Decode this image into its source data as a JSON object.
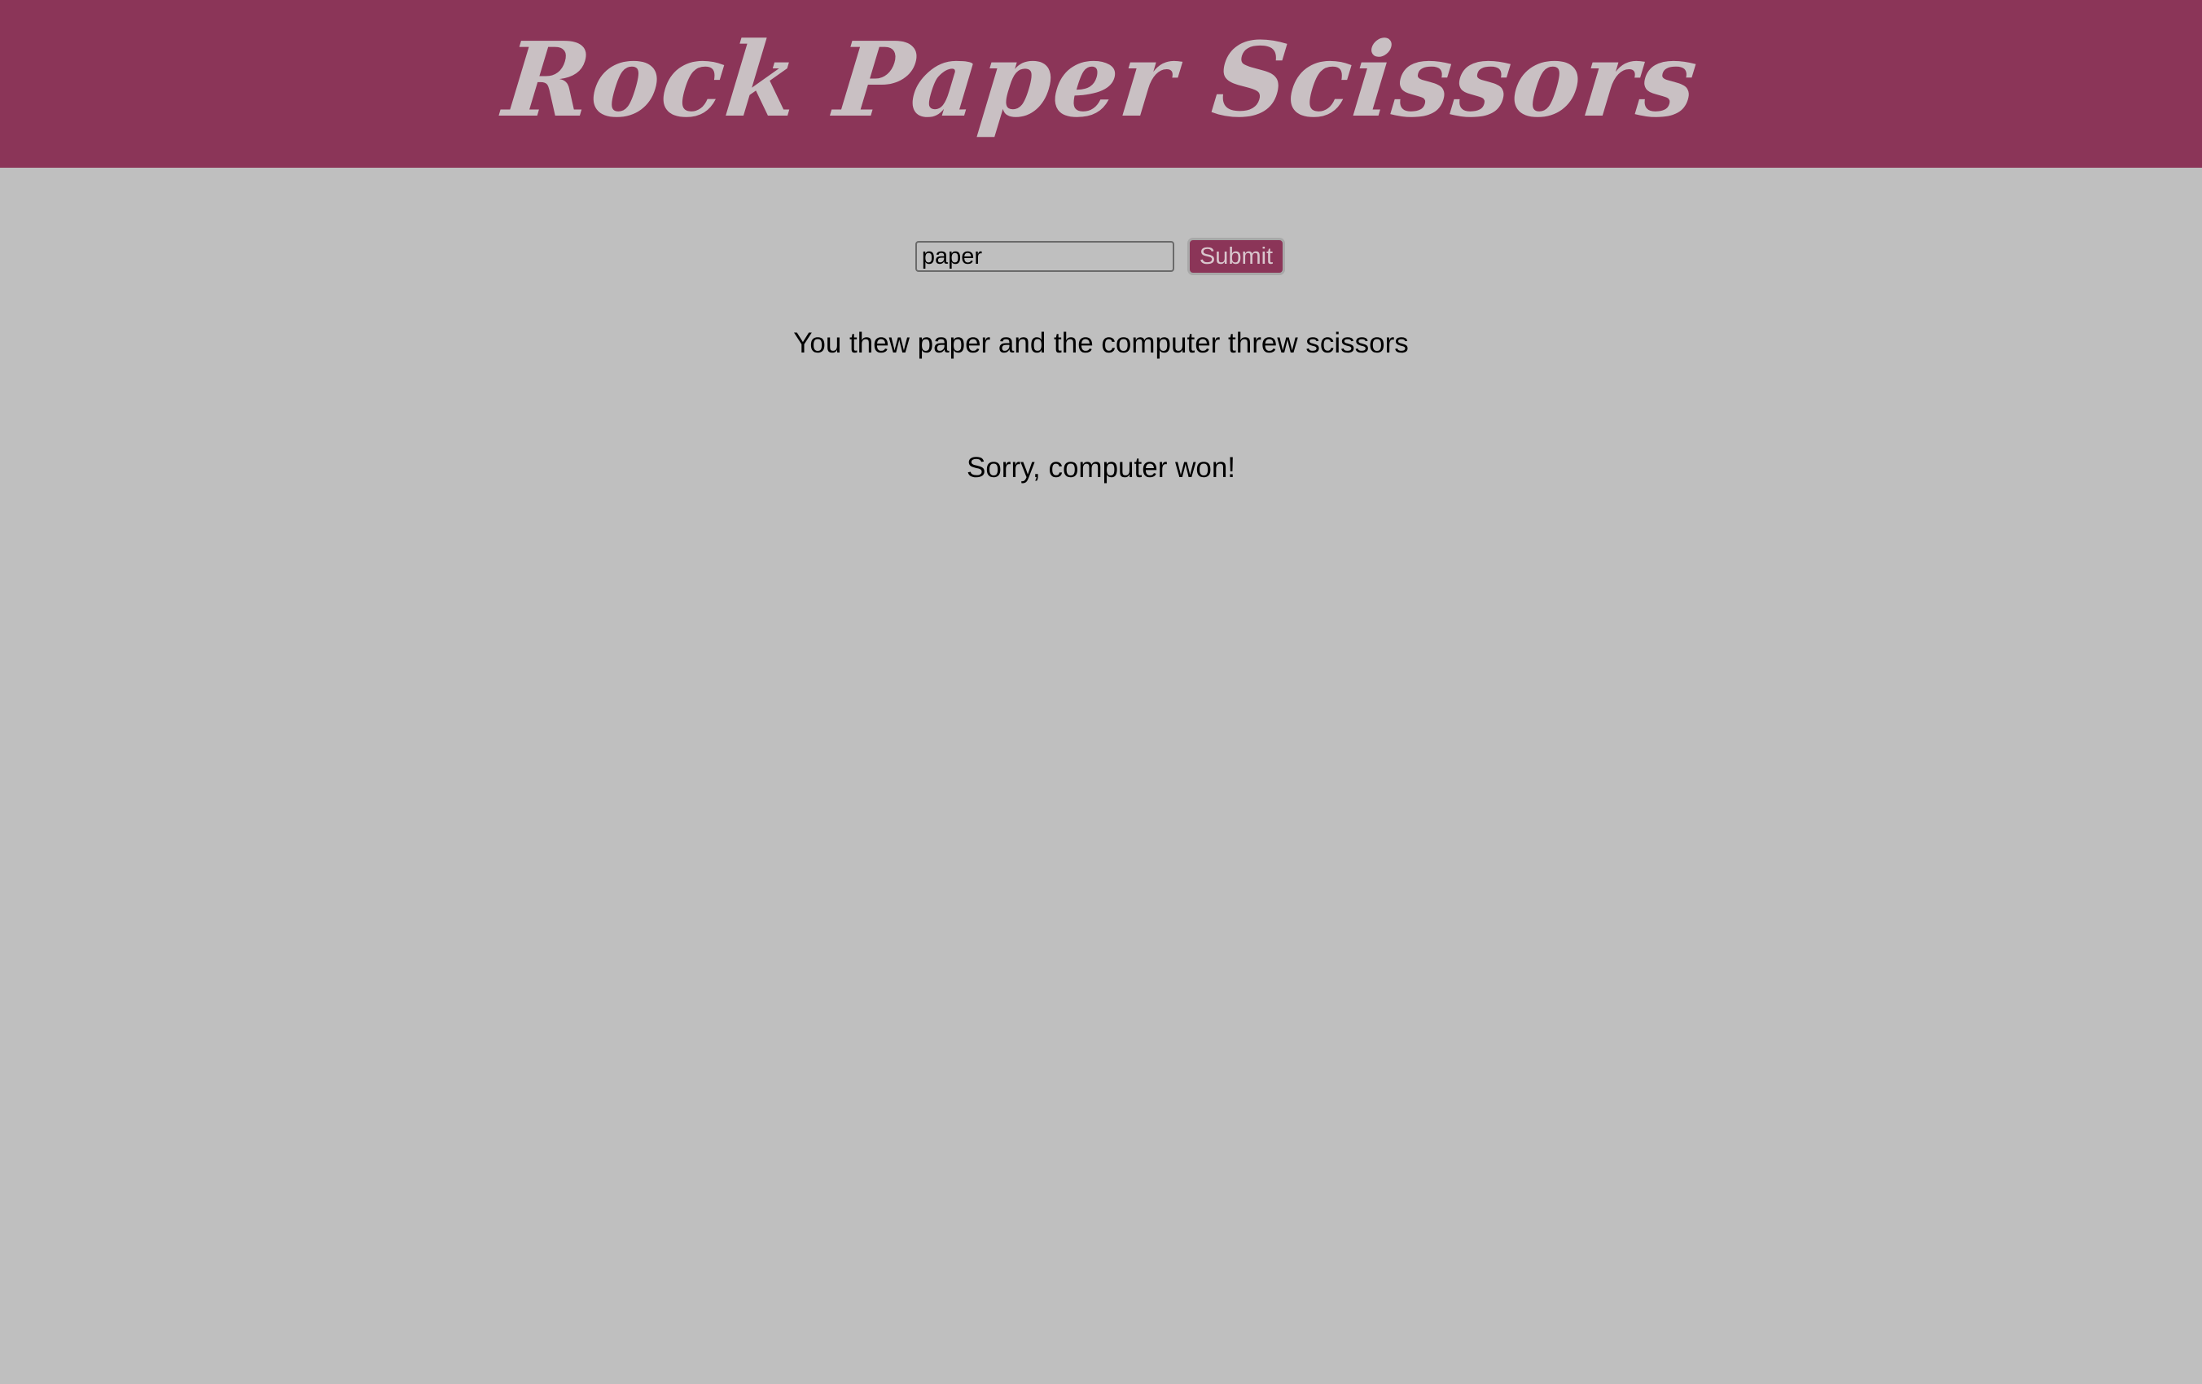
{
  "header": {
    "title": "Rock Paper Scissors",
    "background_color": "#8b3558",
    "title_color": "#c9c0c3"
  },
  "form": {
    "input_value": "paper",
    "submit_label": "Submit"
  },
  "result": {
    "throw_text": "You thew paper and the computer threw scissors",
    "outcome_text": "Sorry, computer won!"
  },
  "page": {
    "background_color": "#bfbfbf"
  }
}
